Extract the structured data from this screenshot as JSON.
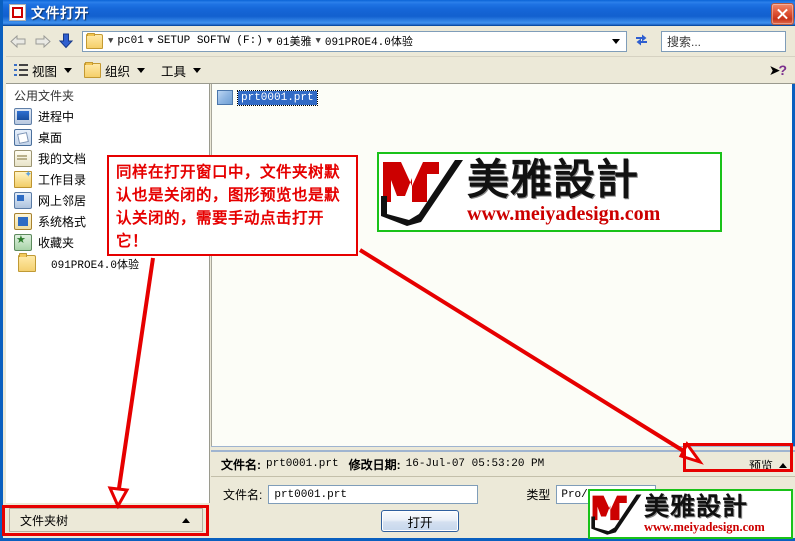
{
  "window": {
    "title": "文件打开",
    "icon": "window-icon",
    "close_label": "×"
  },
  "address": {
    "back_icon": "back-arrow-icon",
    "forward_icon": "forward-arrow-icon",
    "down_icon": "down-arrow-icon",
    "folder_icon": "folder-icon",
    "crumbs": [
      "pc01",
      "SETUP SOFTW (F:)",
      "01美雅",
      "091PROE4.0体验"
    ],
    "separator": "▼",
    "dropdown_icon": "chevron-down-icon",
    "refresh_icon": "refresh-icon",
    "search_placeholder": "搜索..."
  },
  "toolbar": {
    "view_label": "视图",
    "view_icon": "list-view-icon",
    "organize_label": "组织",
    "organize_icon": "folder-new-icon",
    "tools_label": "工具",
    "help_icon": "help-cursor-icon",
    "help_glyph": "?"
  },
  "sidebar": {
    "group_title": "公用文件夹",
    "items": [
      {
        "label": "进程中",
        "icon": "monitor-icon"
      },
      {
        "label": "桌面",
        "icon": "desktop-icon"
      },
      {
        "label": "我的文档",
        "icon": "my-documents-icon"
      },
      {
        "label": "工作目录",
        "icon": "working-directory-icon"
      },
      {
        "label": "网上邻居",
        "icon": "network-neighborhood-icon"
      },
      {
        "label": "系统格式",
        "icon": "system-format-icon"
      },
      {
        "label": "收藏夹",
        "icon": "favorites-icon"
      }
    ],
    "folder_item": {
      "label": "091PROE4.0体验",
      "icon": "folder-icon"
    }
  },
  "filelist": {
    "items": [
      {
        "name": "prt0001.prt",
        "icon": "part-file-icon",
        "selected": true
      }
    ]
  },
  "infobar": {
    "filename_key": "文件名:",
    "filename_value": "prt0001.prt",
    "moddate_key": "修改日期:",
    "moddate_value": "16-Jul-07 05:53:20 PM",
    "preview_label": "预览",
    "preview_caret": "triangle-up-icon"
  },
  "form": {
    "filename_label": "文件名:",
    "filename_value": "prt0001.prt",
    "type_label": "类型",
    "type_value": "Pro/ENGINEE",
    "open_button": "打开"
  },
  "foldertree": {
    "label": "文件夹树",
    "caret": "triangle-up-icon"
  },
  "annotation": {
    "text": "同样在打开窗口中，文件夹树默认也是关闭的，图形预览也是默认关闭的，需要手动点击打开它！",
    "color": "#e60000"
  },
  "watermark": {
    "logo_letter": "M",
    "brand": "美雅設計",
    "url": "www.meiyadesign.com",
    "border_color": "#19c219",
    "logo_color": "#cc0000"
  },
  "colors": {
    "title_blue": "#1260cf",
    "frame_blue": "#0a5fbf",
    "face": "#ece9d8",
    "selection_blue": "#316ac5",
    "annotation_red": "#e60000"
  }
}
